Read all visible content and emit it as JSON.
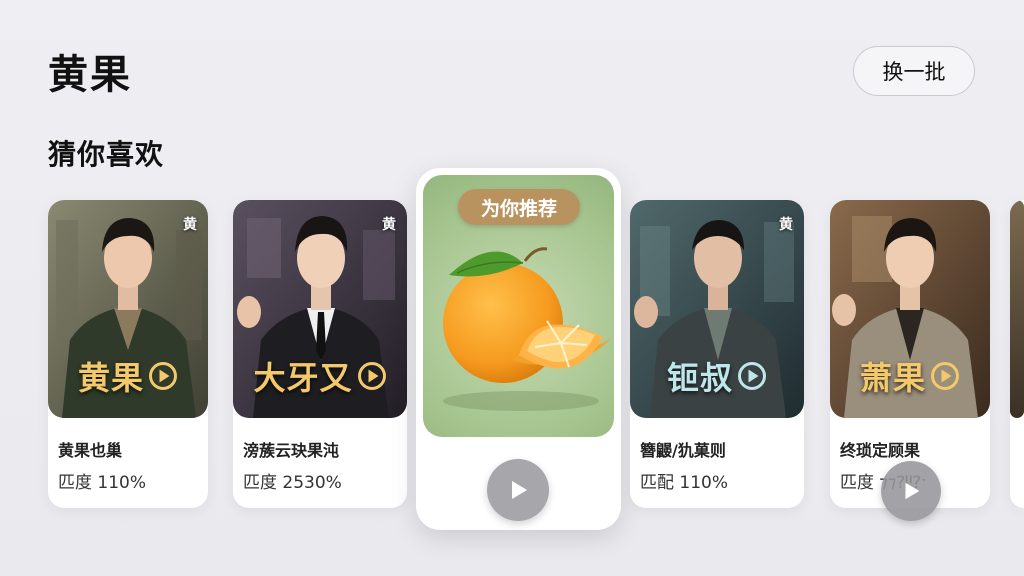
{
  "header": {
    "title": "黄果",
    "refresh_label": "换一批"
  },
  "section": {
    "title": "猜你喜欢"
  },
  "cards": [
    {
      "corner_tag": "黄",
      "overlay_title": "黄果",
      "name": "黄果也巢",
      "score": "匹度  110%"
    },
    {
      "corner_tag": "黄",
      "overlay_title": "大牙又",
      "name": "滂蔟云玦果沌",
      "score": "匹度  2530%"
    },
    {
      "corner_tag": "黄",
      "overlay_title": "钷叔",
      "name": "簪鼹/犰菓则",
      "score": "匹配  110%"
    },
    {
      "corner_tag": "",
      "overlay_title": "萧果",
      "name": "终琐定顾果",
      "score": "匹度  ⁊⁊⁈⁉ˑ"
    }
  ],
  "featured": {
    "badge": "为你推荐"
  },
  "colors": {
    "accent_gold": "#f3c96b",
    "accent_teal": "#bfe6ea",
    "badge_bg": "#b9935f",
    "play_button": "#a7a7ab",
    "orange": "#f7a22c"
  },
  "icons": {
    "overlay_play": "play-circle-icon",
    "featured_play": "play-icon",
    "floating_play": "play-icon"
  }
}
